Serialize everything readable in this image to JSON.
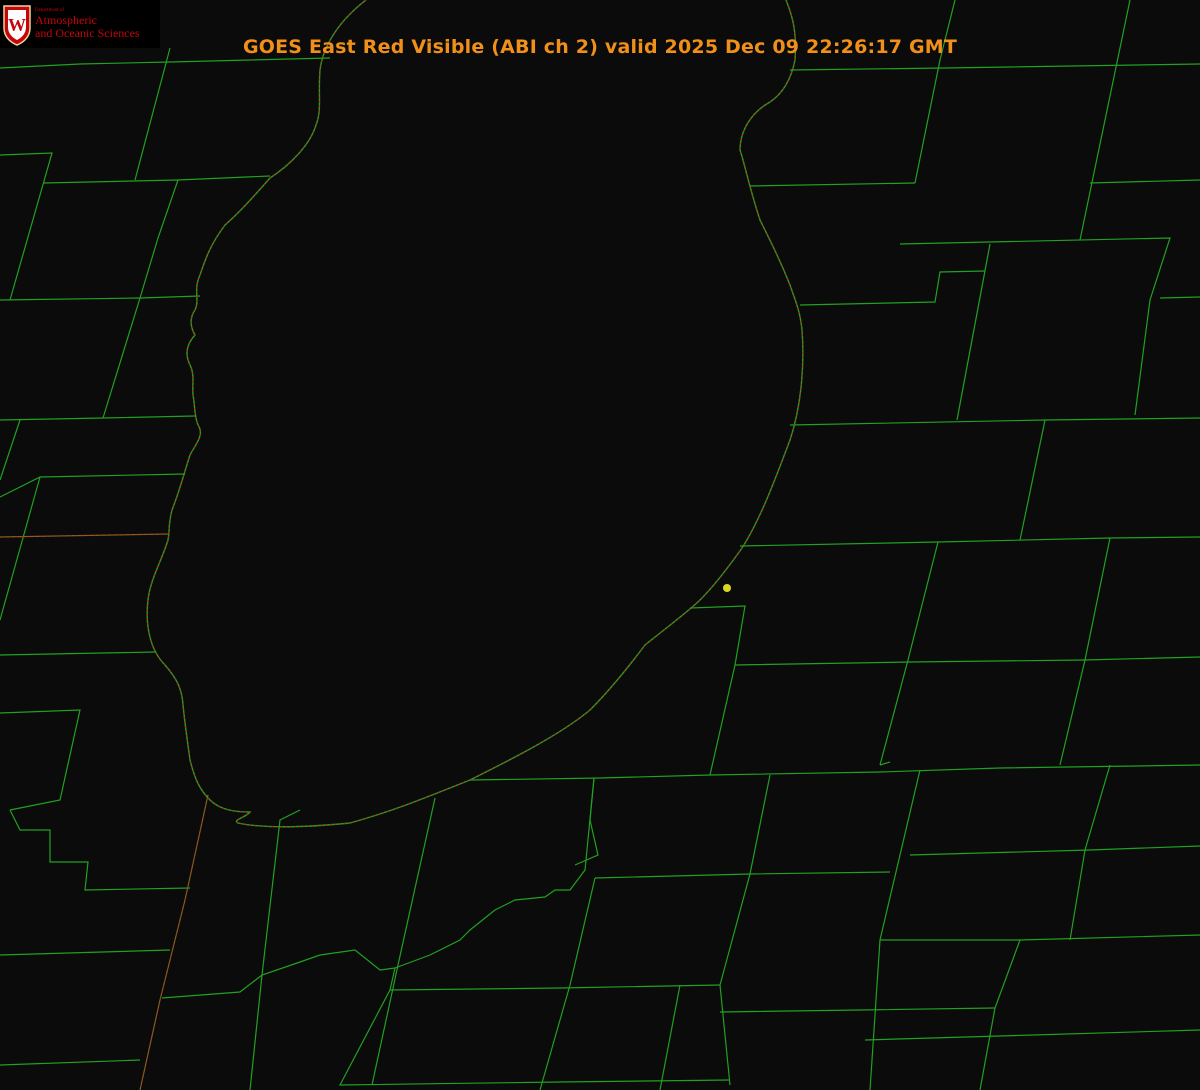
{
  "title": "GOES East Red Visible (ABI ch 2) valid 2025 Dec 09 22:26:17 GMT",
  "logo": {
    "dept_line": "Department of",
    "name_line1": "Atmospheric",
    "name_line2": "and Oceanic Sciences",
    "shield_letter": "W"
  },
  "colors": {
    "background": "#0b0b0b",
    "boundary_lines": "#22a022",
    "shoreline_dotted": "#c81e1e",
    "state_line": "#b04020",
    "marker": "#d8d820",
    "title_text": "#f0901a",
    "logo_red": "#c5050c"
  },
  "map_layers": [
    "county-boundaries",
    "state-boundary",
    "lake-shoreline",
    "observation-marker"
  ]
}
